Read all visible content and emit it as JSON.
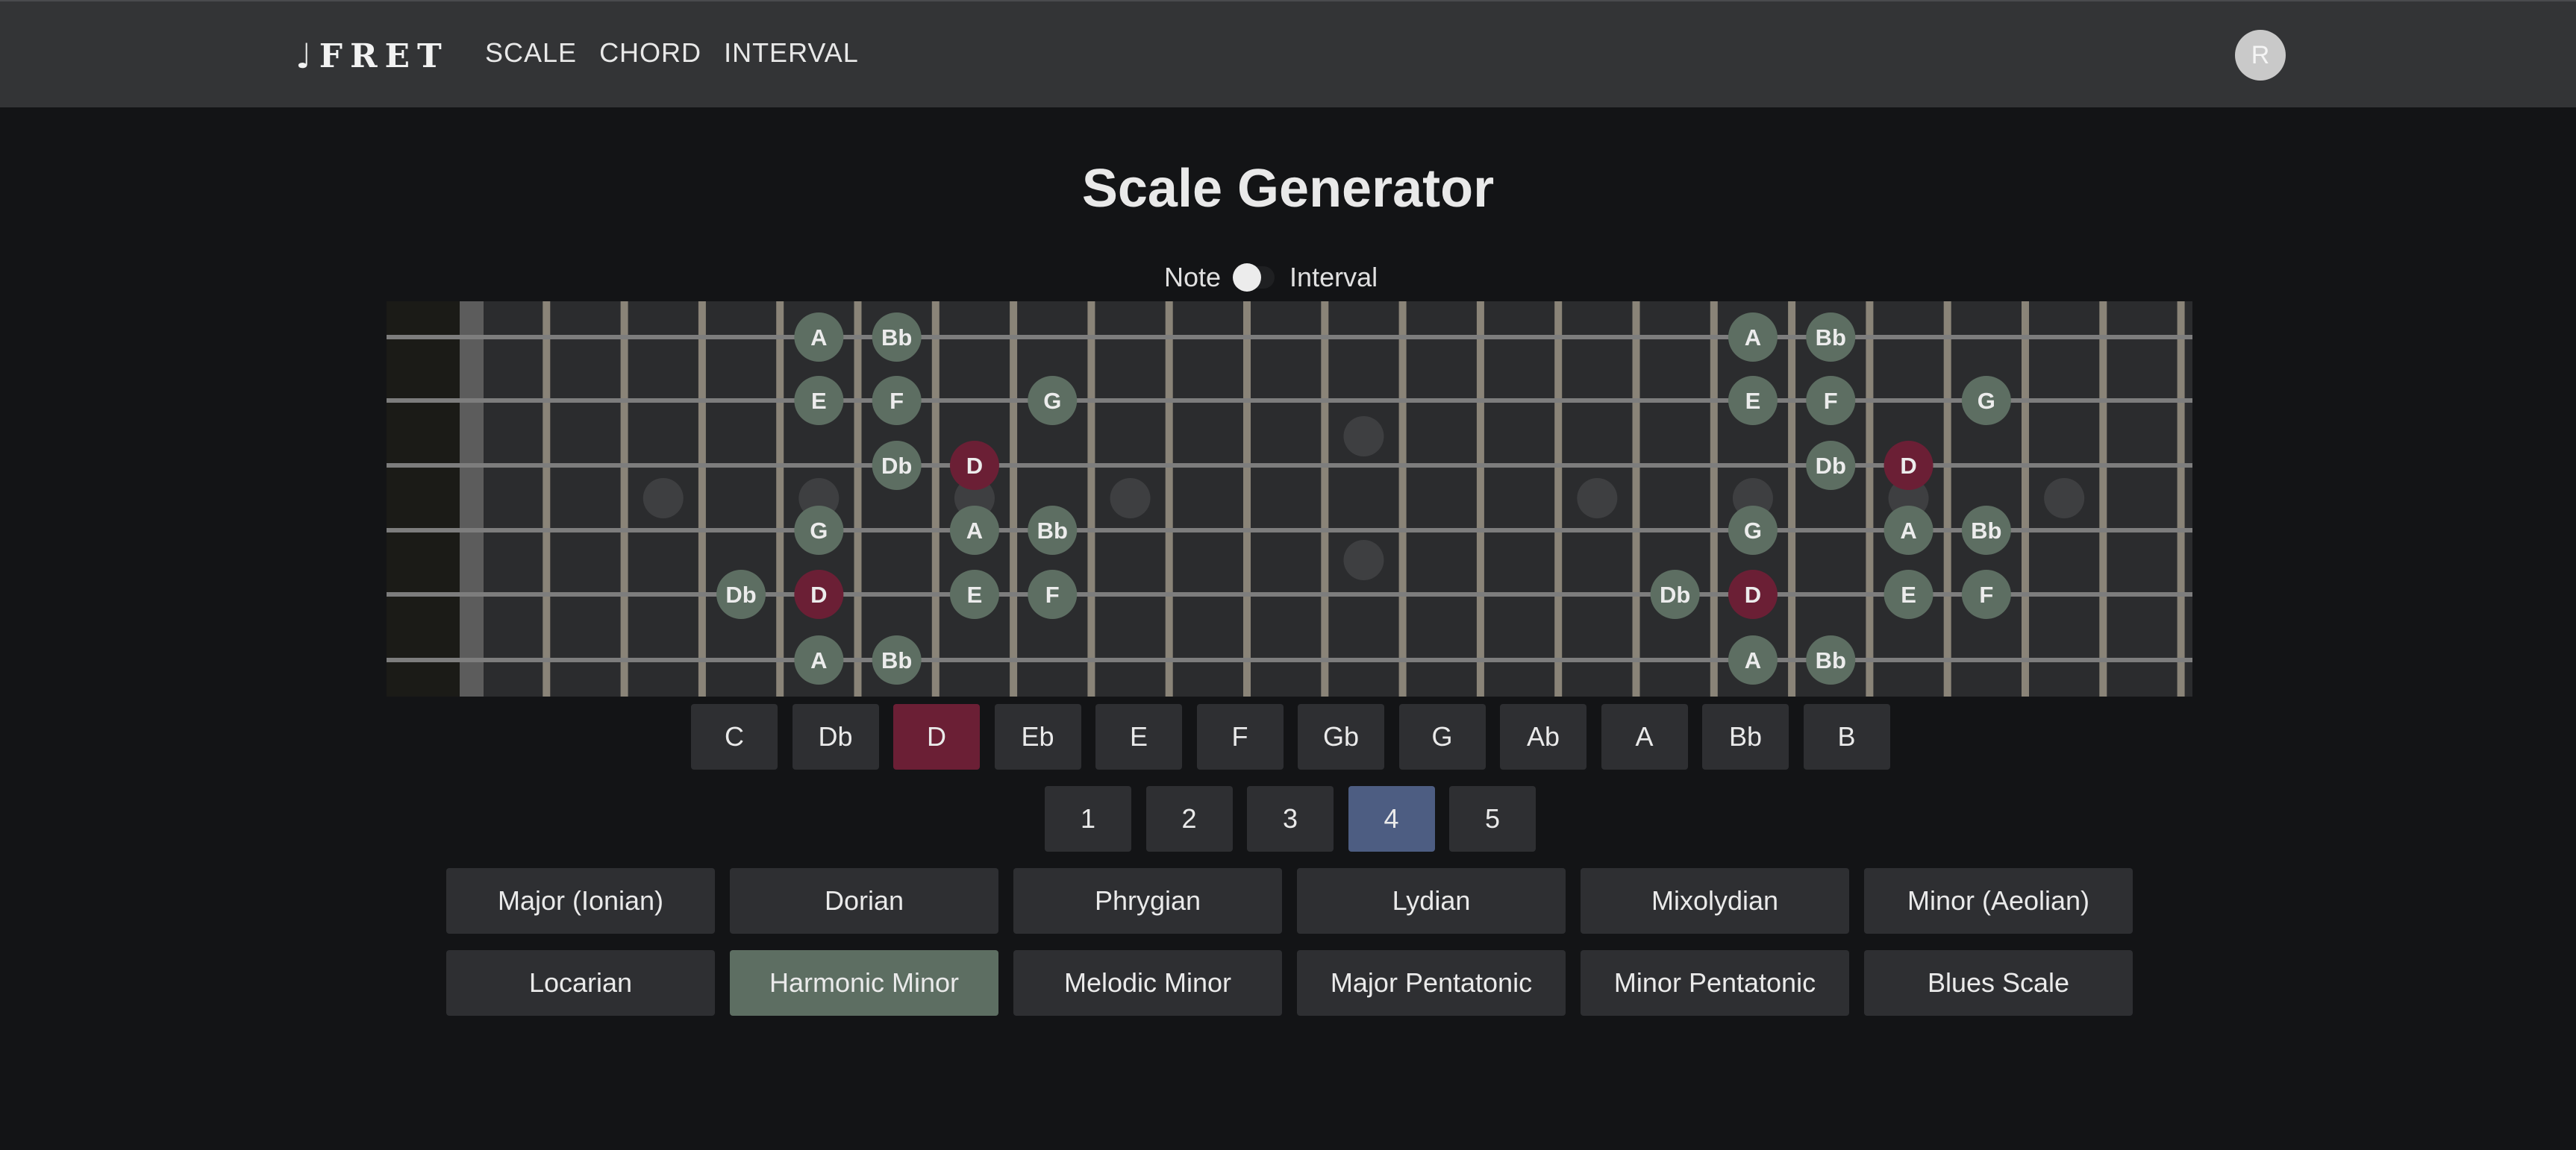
{
  "app": {
    "logo_glyph": "♩",
    "logo_text": "FRET",
    "nav": [
      "SCALE",
      "CHORD",
      "INTERVAL"
    ],
    "avatar_initial": "R"
  },
  "page": {
    "title": "Scale Generator",
    "toggle_left": "Note",
    "toggle_right": "Interval",
    "toggle_state": "Note"
  },
  "colors": {
    "root_note": "#6b1f35",
    "scale_note": "#5d6e62",
    "selected_position": "#4d5d82",
    "selected_scale": "#5d6e62",
    "fretboard": "#2b2c2e",
    "fret_wire": "#8a8478",
    "string": "#7d7d7d",
    "inlay": "#3e3f41"
  },
  "fretboard": {
    "strings_top_to_bottom": [
      "e",
      "B",
      "G",
      "D",
      "A",
      "E"
    ],
    "fret_count": 22,
    "inlay_frets_single": [
      3,
      5,
      7,
      9,
      15,
      17,
      19,
      21
    ],
    "inlay_frets_double": [
      12
    ],
    "notes": [
      {
        "string": 0,
        "fret": 5,
        "label": "A",
        "root": false
      },
      {
        "string": 0,
        "fret": 6,
        "label": "Bb",
        "root": false
      },
      {
        "string": 1,
        "fret": 5,
        "label": "E",
        "root": false
      },
      {
        "string": 1,
        "fret": 6,
        "label": "F",
        "root": false
      },
      {
        "string": 1,
        "fret": 8,
        "label": "G",
        "root": false
      },
      {
        "string": 2,
        "fret": 6,
        "label": "Db",
        "root": false
      },
      {
        "string": 2,
        "fret": 7,
        "label": "D",
        "root": true
      },
      {
        "string": 3,
        "fret": 5,
        "label": "G",
        "root": false
      },
      {
        "string": 3,
        "fret": 7,
        "label": "A",
        "root": false
      },
      {
        "string": 3,
        "fret": 8,
        "label": "Bb",
        "root": false
      },
      {
        "string": 4,
        "fret": 4,
        "label": "Db",
        "root": false
      },
      {
        "string": 4,
        "fret": 5,
        "label": "D",
        "root": true
      },
      {
        "string": 4,
        "fret": 7,
        "label": "E",
        "root": false
      },
      {
        "string": 4,
        "fret": 8,
        "label": "F",
        "root": false
      },
      {
        "string": 5,
        "fret": 5,
        "label": "A",
        "root": false
      },
      {
        "string": 5,
        "fret": 6,
        "label": "Bb",
        "root": false
      },
      {
        "string": 0,
        "fret": 17,
        "label": "A",
        "root": false
      },
      {
        "string": 0,
        "fret": 18,
        "label": "Bb",
        "root": false
      },
      {
        "string": 1,
        "fret": 17,
        "label": "E",
        "root": false
      },
      {
        "string": 1,
        "fret": 18,
        "label": "F",
        "root": false
      },
      {
        "string": 1,
        "fret": 20,
        "label": "G",
        "root": false
      },
      {
        "string": 2,
        "fret": 18,
        "label": "Db",
        "root": false
      },
      {
        "string": 2,
        "fret": 19,
        "label": "D",
        "root": true
      },
      {
        "string": 3,
        "fret": 17,
        "label": "G",
        "root": false
      },
      {
        "string": 3,
        "fret": 19,
        "label": "A",
        "root": false
      },
      {
        "string": 3,
        "fret": 20,
        "label": "Bb",
        "root": false
      },
      {
        "string": 4,
        "fret": 16,
        "label": "Db",
        "root": false
      },
      {
        "string": 4,
        "fret": 17,
        "label": "D",
        "root": true
      },
      {
        "string": 4,
        "fret": 19,
        "label": "E",
        "root": false
      },
      {
        "string": 4,
        "fret": 20,
        "label": "F",
        "root": false
      },
      {
        "string": 5,
        "fret": 17,
        "label": "A",
        "root": false
      },
      {
        "string": 5,
        "fret": 18,
        "label": "Bb",
        "root": false
      }
    ]
  },
  "root_notes": {
    "options": [
      "C",
      "Db",
      "D",
      "Eb",
      "E",
      "F",
      "Gb",
      "G",
      "Ab",
      "A",
      "Bb",
      "B"
    ],
    "selected": "D"
  },
  "positions": {
    "options": [
      "1",
      "2",
      "3",
      "4",
      "5"
    ],
    "selected": "4"
  },
  "scales": {
    "options": [
      "Major (Ionian)",
      "Dorian",
      "Phrygian",
      "Lydian",
      "Mixolydian",
      "Minor (Aeolian)",
      "Locarian",
      "Harmonic Minor",
      "Melodic Minor",
      "Major Pentatonic",
      "Minor Pentatonic",
      "Blues Scale"
    ],
    "selected": "Harmonic Minor"
  }
}
